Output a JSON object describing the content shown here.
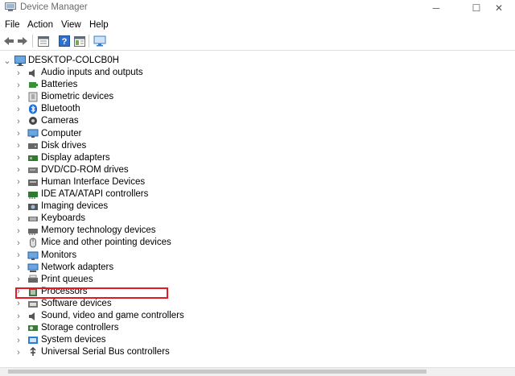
{
  "window": {
    "title": "Device Manager",
    "minimize": "─",
    "maximize": "☐",
    "close": "✕"
  },
  "menu": [
    "File",
    "Action",
    "View",
    "Help"
  ],
  "toolbar": [
    {
      "name": "back-icon",
      "glyph": "🡐"
    },
    {
      "name": "forward-icon",
      "glyph": "🡒"
    },
    {
      "name": "properties-icon",
      "glyph": "▤"
    },
    {
      "name": "help-icon",
      "glyph": "?"
    },
    {
      "name": "show-hide-icon",
      "glyph": "▦"
    },
    {
      "name": "monitor-icon",
      "glyph": "🖵"
    }
  ],
  "root": {
    "label": "DESKTOP-COLCB0H",
    "expander": "⌄"
  },
  "expander_collapsed": "›",
  "items": [
    {
      "label": "Audio inputs and outputs",
      "icon": "speaker-icon",
      "color": "#555"
    },
    {
      "label": "Batteries",
      "icon": "battery-icon",
      "color": "#3a8f3a"
    },
    {
      "label": "Biometric devices",
      "icon": "fingerprint-icon",
      "color": "#777"
    },
    {
      "label": "Bluetooth",
      "icon": "bluetooth-icon",
      "color": "#1e6fd9"
    },
    {
      "label": "Cameras",
      "icon": "camera-icon",
      "color": "#444"
    },
    {
      "label": "Computer",
      "icon": "computer-icon",
      "color": "#2a7fd4"
    },
    {
      "label": "Disk drives",
      "icon": "disk-icon",
      "color": "#666"
    },
    {
      "label": "Display adapters",
      "icon": "display-adapter-icon",
      "color": "#2f7a2f"
    },
    {
      "label": "DVD/CD-ROM drives",
      "icon": "dvd-icon",
      "color": "#777"
    },
    {
      "label": "Human Interface Devices",
      "icon": "hid-icon",
      "color": "#666"
    },
    {
      "label": "IDE ATA/ATAPI controllers",
      "icon": "ide-icon",
      "color": "#2f7a2f"
    },
    {
      "label": "Imaging devices",
      "icon": "imaging-icon",
      "color": "#555"
    },
    {
      "label": "Keyboards",
      "icon": "keyboard-icon",
      "color": "#777"
    },
    {
      "label": "Memory technology devices",
      "icon": "memory-icon",
      "color": "#666"
    },
    {
      "label": "Mice and other pointing devices",
      "icon": "mouse-icon",
      "color": "#666"
    },
    {
      "label": "Monitors",
      "icon": "monitor-icon",
      "color": "#2a7fd4"
    },
    {
      "label": "Network adapters",
      "icon": "network-icon",
      "color": "#2a7fd4"
    },
    {
      "label": "Print queues",
      "icon": "printer-icon",
      "color": "#666"
    },
    {
      "label": "Processors",
      "icon": "processor-icon",
      "color": "#3a7a3a"
    },
    {
      "label": "Software devices",
      "icon": "software-device-icon",
      "color": "#777"
    },
    {
      "label": "Sound, video and game controllers",
      "icon": "sound-icon",
      "color": "#555"
    },
    {
      "label": "Storage controllers",
      "icon": "storage-icon",
      "color": "#3a7a3a"
    },
    {
      "label": "System devices",
      "icon": "system-icon",
      "color": "#2a7fd4"
    },
    {
      "label": "Universal Serial Bus controllers",
      "icon": "usb-icon",
      "color": "#444"
    }
  ],
  "highlight_color": "#e01b24"
}
